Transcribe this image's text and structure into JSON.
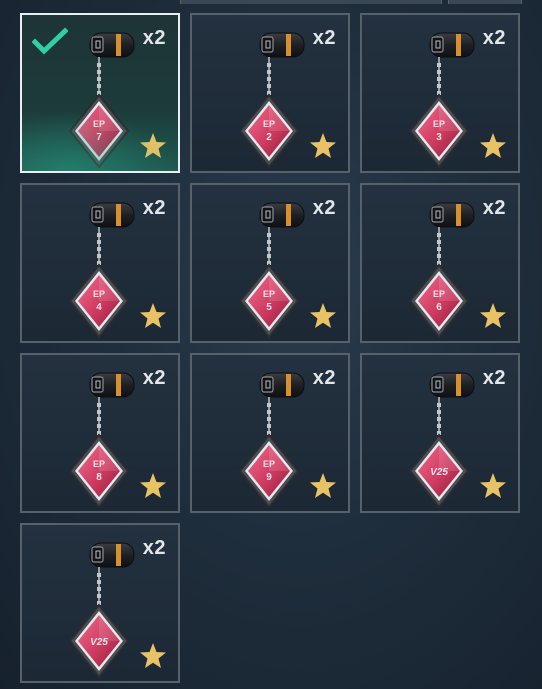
{
  "colors": {
    "selected_check": "#2fd0a4",
    "star": "#e9c266",
    "charm_fill": "#cf3a60",
    "charm_frame": "#4a4d52",
    "quantity_text": "#e3e6e8"
  },
  "items": [
    {
      "badge": "EP 7",
      "label_top": "EP",
      "label_bottom": "7",
      "quantity": "x2",
      "selected": true,
      "rated": true
    },
    {
      "badge": "EP 2",
      "label_top": "EP",
      "label_bottom": "2",
      "quantity": "x2",
      "selected": false,
      "rated": true
    },
    {
      "badge": "EP 3",
      "label_top": "EP",
      "label_bottom": "3",
      "quantity": "x2",
      "selected": false,
      "rated": true
    },
    {
      "badge": "EP 4",
      "label_top": "EP",
      "label_bottom": "4",
      "quantity": "x2",
      "selected": false,
      "rated": true
    },
    {
      "badge": "EP 5",
      "label_top": "EP",
      "label_bottom": "5",
      "quantity": "x2",
      "selected": false,
      "rated": true
    },
    {
      "badge": "EP 6",
      "label_top": "EP",
      "label_bottom": "6",
      "quantity": "x2",
      "selected": false,
      "rated": true
    },
    {
      "badge": "EP 8",
      "label_top": "EP",
      "label_bottom": "8",
      "quantity": "x2",
      "selected": false,
      "rated": true
    },
    {
      "badge": "EP 9",
      "label_top": "EP",
      "label_bottom": "9",
      "quantity": "x2",
      "selected": false,
      "rated": true
    },
    {
      "badge": "V25",
      "label_top": "V25",
      "label_bottom": "",
      "quantity": "x2",
      "selected": false,
      "rated": true
    },
    {
      "badge": "V25",
      "label_top": "V25",
      "label_bottom": "",
      "quantity": "x2",
      "selected": false,
      "rated": true
    }
  ]
}
